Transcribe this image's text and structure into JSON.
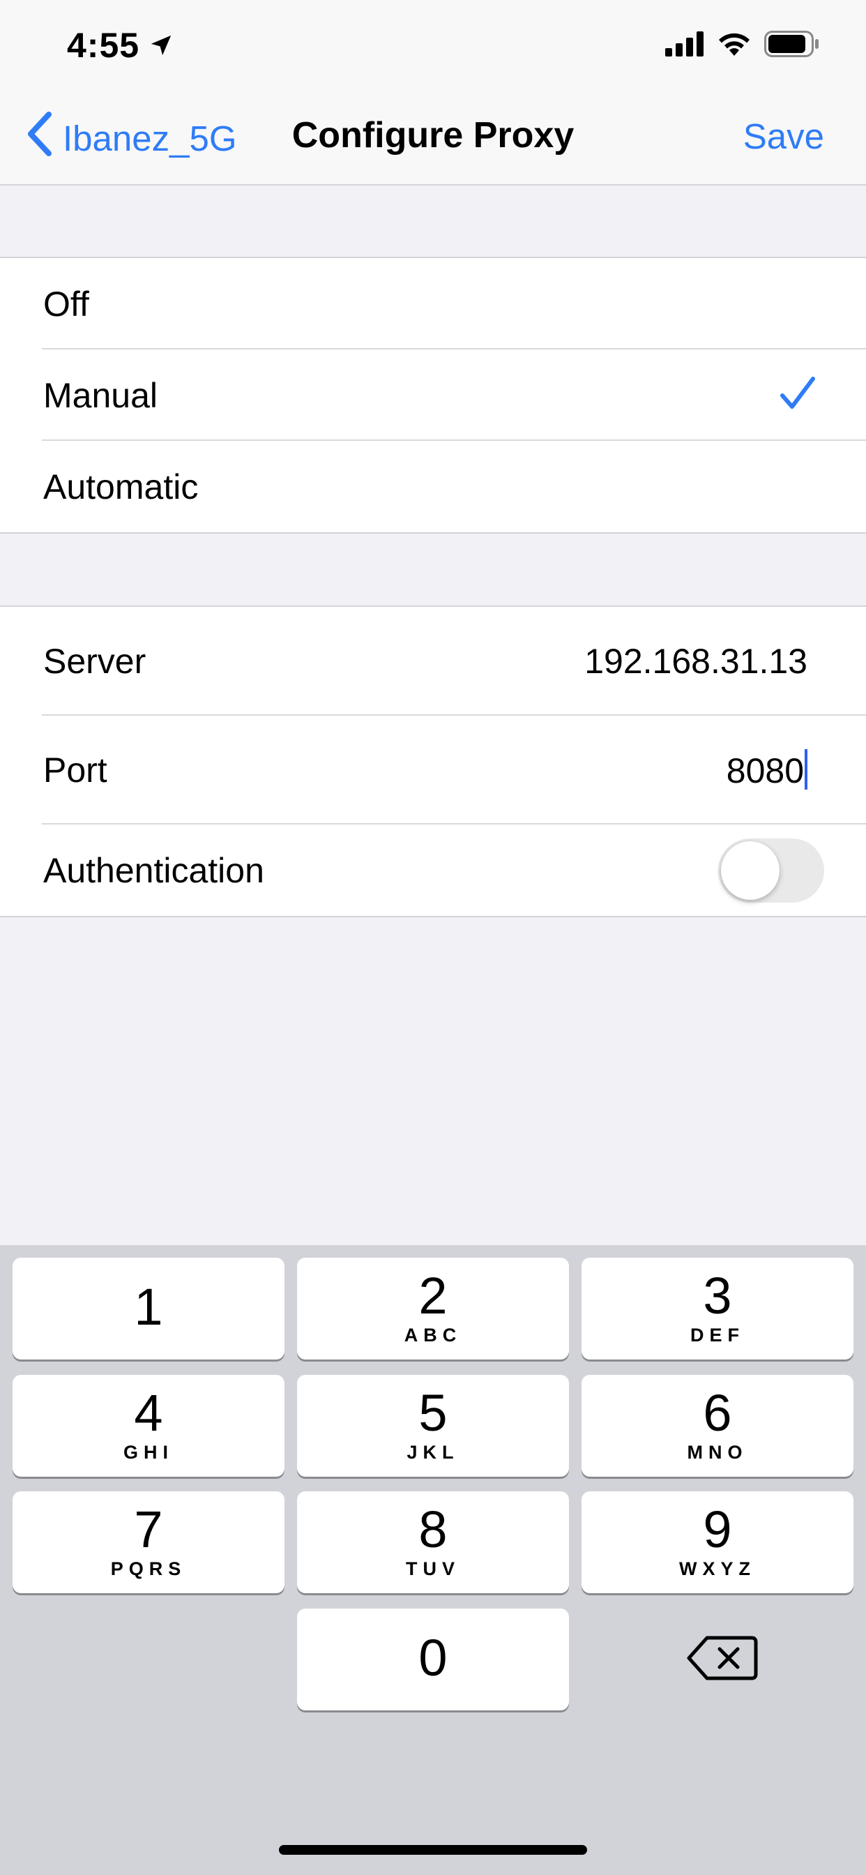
{
  "status_bar": {
    "time": "4:55",
    "icons": [
      "location-arrow-icon",
      "signal-icon",
      "wifi-icon",
      "battery-icon"
    ]
  },
  "nav": {
    "back_label": "Ibanez_5G",
    "title": "Configure Proxy",
    "save_label": "Save"
  },
  "proxy_mode": {
    "options": [
      {
        "label": "Off",
        "selected": false
      },
      {
        "label": "Manual",
        "selected": true
      },
      {
        "label": "Automatic",
        "selected": false
      }
    ]
  },
  "settings": {
    "server": {
      "label": "Server",
      "value": "192.168.31.13"
    },
    "port": {
      "label": "Port",
      "value": "8080"
    },
    "authentication": {
      "label": "Authentication",
      "enabled": false
    }
  },
  "keypad": {
    "keys": [
      {
        "num": "1",
        "letters": ""
      },
      {
        "num": "2",
        "letters": "ABC"
      },
      {
        "num": "3",
        "letters": "DEF"
      },
      {
        "num": "4",
        "letters": "GHI"
      },
      {
        "num": "5",
        "letters": "JKL"
      },
      {
        "num": "6",
        "letters": "MNO"
      },
      {
        "num": "7",
        "letters": "PQRS"
      },
      {
        "num": "8",
        "letters": "TUV"
      },
      {
        "num": "9",
        "letters": "WXYZ"
      },
      {
        "num": "0",
        "letters": ""
      }
    ],
    "delete_icon": "backspace-icon"
  },
  "colors": {
    "accent": "#2f7cf6",
    "background": "#f1f1f6",
    "keypad_background": "#d1d3d9"
  }
}
